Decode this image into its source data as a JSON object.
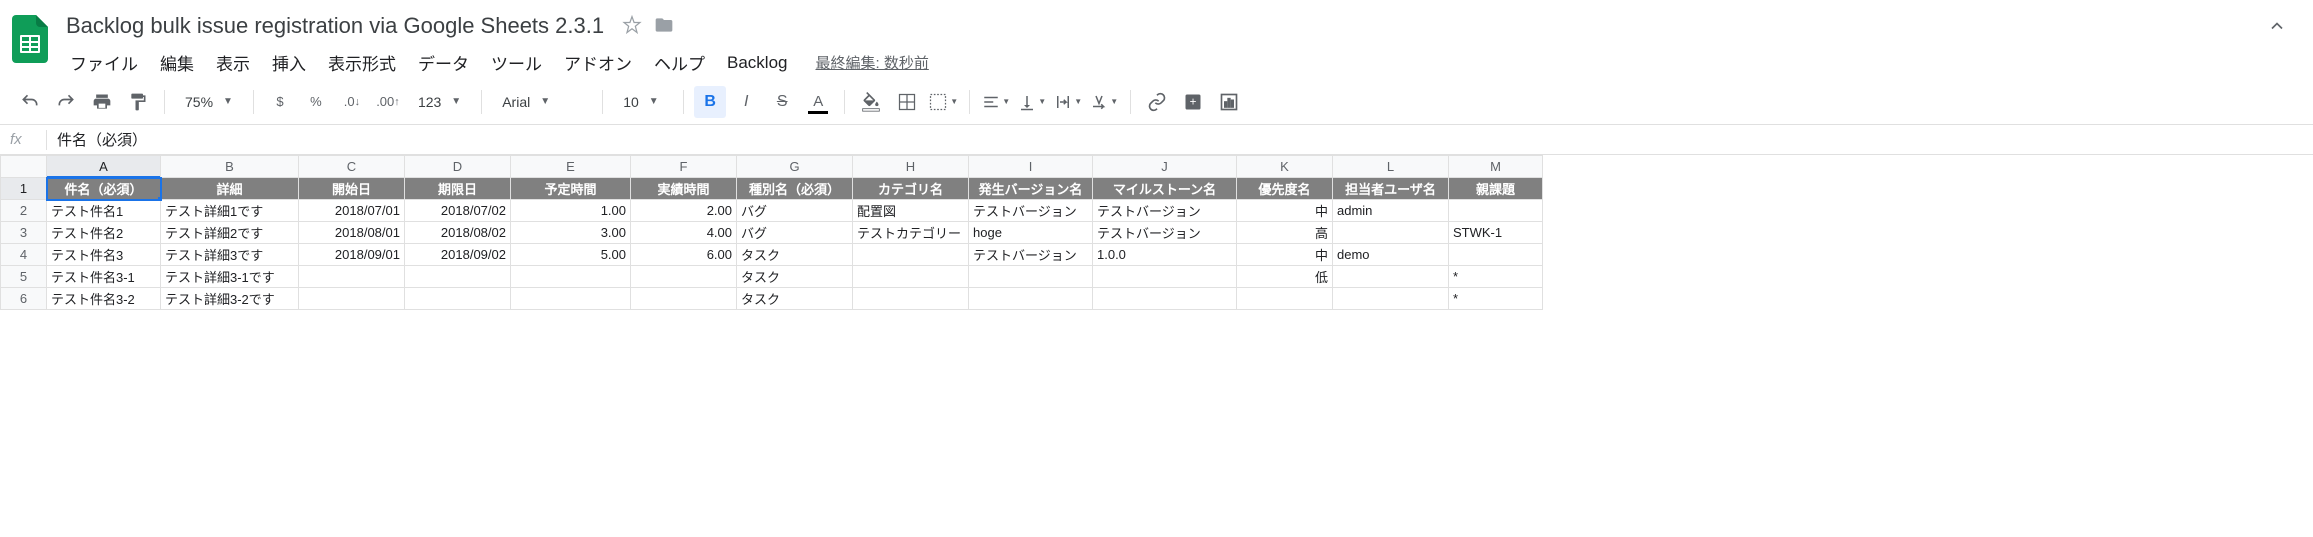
{
  "doc": {
    "title": "Backlog bulk issue registration via Google Sheets 2.3.1",
    "last_edit": "最終編集: 数秒前"
  },
  "menu": {
    "file": "ファイル",
    "edit": "編集",
    "view": "表示",
    "insert": "挿入",
    "format": "表示形式",
    "data": "データ",
    "tools": "ツール",
    "addons": "アドオン",
    "help": "ヘルプ",
    "backlog": "Backlog"
  },
  "toolbar": {
    "zoom": "75%",
    "currency": "$",
    "percent": "%",
    "dec_dec": ".0",
    "inc_dec": ".00",
    "more_fmt": "123",
    "font": "Arial",
    "size": "10",
    "bold": "B",
    "italic": "I",
    "strike": "S",
    "textcolor": "A"
  },
  "formula": {
    "fx": "fx",
    "value": "件名（必須）"
  },
  "columns": [
    "A",
    "B",
    "C",
    "D",
    "E",
    "F",
    "G",
    "H",
    "I",
    "J",
    "K",
    "L",
    "M"
  ],
  "active_col": "A",
  "active_row": "1",
  "headers": {
    "A": "件名（必須）",
    "B": "詳細",
    "C": "開始日",
    "D": "期限日",
    "E": "予定時間",
    "F": "実績時間",
    "G": "種別名（必須）",
    "H": "カテゴリ名",
    "I": "発生バージョン名",
    "J": "マイルストーン名",
    "K": "優先度名",
    "L": "担当者ユーザ名",
    "M": "親課題"
  },
  "rows": [
    {
      "n": "2",
      "A": "テスト件名1",
      "B": "テスト詳細1です",
      "C": "2018/07/01",
      "D": "2018/07/02",
      "E": "1.00",
      "F": "2.00",
      "G": "バグ",
      "H": "配置図",
      "I": "テストバージョン",
      "J": "テストバージョン",
      "K": "中",
      "L": "admin",
      "M": ""
    },
    {
      "n": "3",
      "A": "テスト件名2",
      "B": "テスト詳細2です",
      "C": "2018/08/01",
      "D": "2018/08/02",
      "E": "3.00",
      "F": "4.00",
      "G": "バグ",
      "H": "テストカテゴリー",
      "I": "hoge",
      "J": "テストバージョン",
      "K": "高",
      "L": "",
      "M": "STWK-1"
    },
    {
      "n": "4",
      "A": "テスト件名3",
      "B": "テスト詳細3です",
      "C": "2018/09/01",
      "D": "2018/09/02",
      "E": "5.00",
      "F": "6.00",
      "G": "タスク",
      "H": "",
      "I": "テストバージョン",
      "J": "1.0.0",
      "K": "中",
      "L": "demo",
      "M": ""
    },
    {
      "n": "5",
      "A": "テスト件名3-1",
      "B": "テスト詳細3-1です",
      "C": "",
      "D": "",
      "E": "",
      "F": "",
      "G": "タスク",
      "H": "",
      "I": "",
      "J": "",
      "K": "低",
      "L": "",
      "M": "*"
    },
    {
      "n": "6",
      "A": "テスト件名3-2",
      "B": "テスト詳細3-2です",
      "C": "",
      "D": "",
      "E": "",
      "F": "",
      "G": "タスク",
      "H": "",
      "I": "",
      "J": "",
      "K": "",
      "L": "",
      "M": "*"
    }
  ],
  "align": {
    "C": "right",
    "D": "right",
    "E": "right",
    "F": "right",
    "K": "right"
  }
}
